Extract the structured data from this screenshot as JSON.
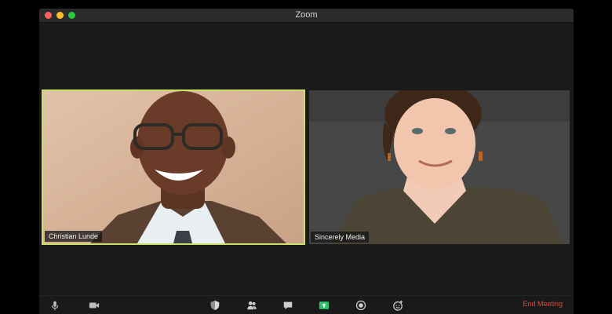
{
  "window": {
    "title": "Zoom"
  },
  "participants": [
    {
      "name": "Christian Lunde",
      "active_speaker": true
    },
    {
      "name": "Sincerely Media",
      "active_speaker": false
    }
  ],
  "toolbar": {
    "icons": [
      "mic-icon",
      "video-camera-icon",
      "security-shield-icon",
      "participants-icon",
      "chat-icon",
      "share-screen-icon",
      "record-icon",
      "reactions-icon"
    ],
    "end_meeting_label": "End Meeting"
  },
  "colors": {
    "active_speaker_border": "#c9e16a",
    "share_screen_green": "#2fc26b",
    "end_meeting_red": "#e8453c"
  }
}
